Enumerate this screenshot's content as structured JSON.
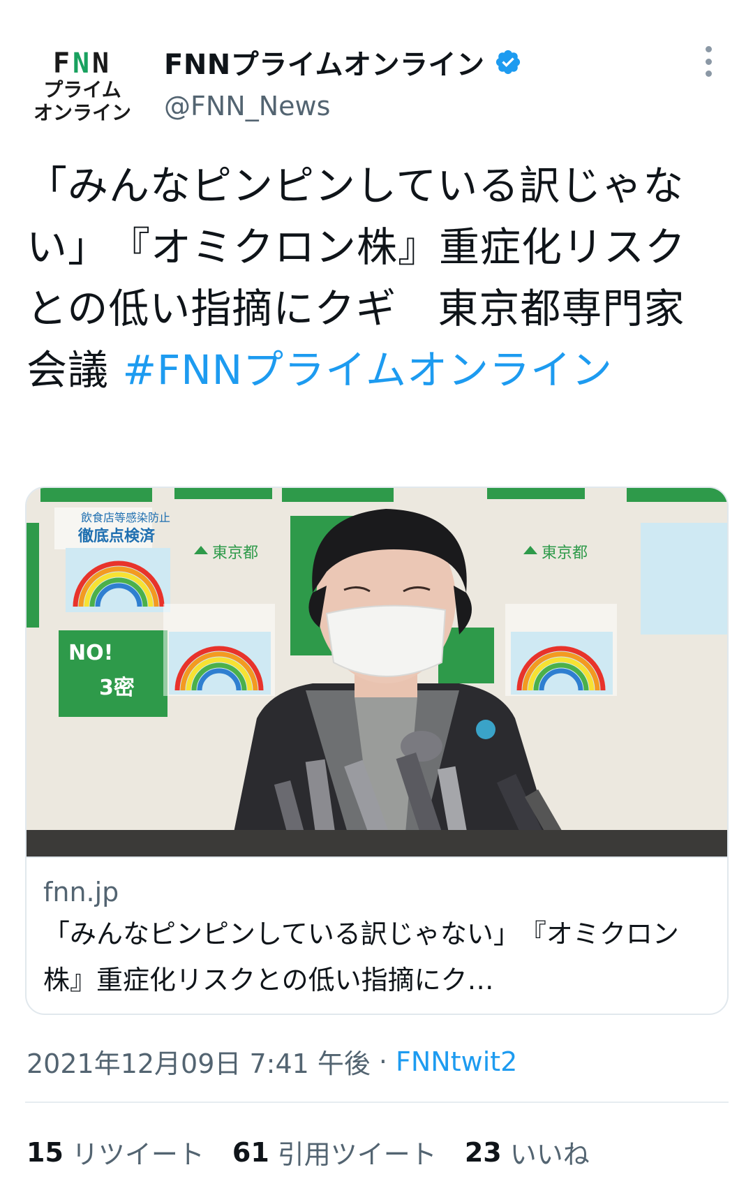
{
  "account": {
    "logo_line1": "FNN",
    "logo_line2": "プライム",
    "logo_line3": "オンライン",
    "display_name": "FNNプライムオンライン",
    "handle": "@FNN_News",
    "verified": true,
    "verified_color": "#1d9bf0"
  },
  "tweet": {
    "text": "「みんなピンピンしている訳じゃない」　『オミクロン株』重症化リスクとの低い指摘にクギ　東京都専門家会議 ",
    "hashtag": "#FNNプライムオンライン"
  },
  "card": {
    "domain": "fnn.jp",
    "title": "「みんなピンピンしている訳じゃない」　『オミクロン株』重症化リスクとの低い指摘にク…",
    "image_text": {
      "poster1": "飲食店等感染防止",
      "poster2": "徹底点検済",
      "tokyo": "東京都",
      "no_label": "NO!",
      "sanmitsu": "3密"
    }
  },
  "meta": {
    "timestamp": "2021年12月09日 7:41 午後",
    "separator": "·",
    "source": "FNNtwit2"
  },
  "stats": {
    "retweets_count": "15",
    "retweets_label": "リツイート",
    "quotes_count": "61",
    "quotes_label": "引用ツイート",
    "likes_count": "23",
    "likes_label": "いいね"
  },
  "colors": {
    "link": "#1d9bf0",
    "secondary_text": "#536471",
    "primary_text": "#0f1419"
  }
}
